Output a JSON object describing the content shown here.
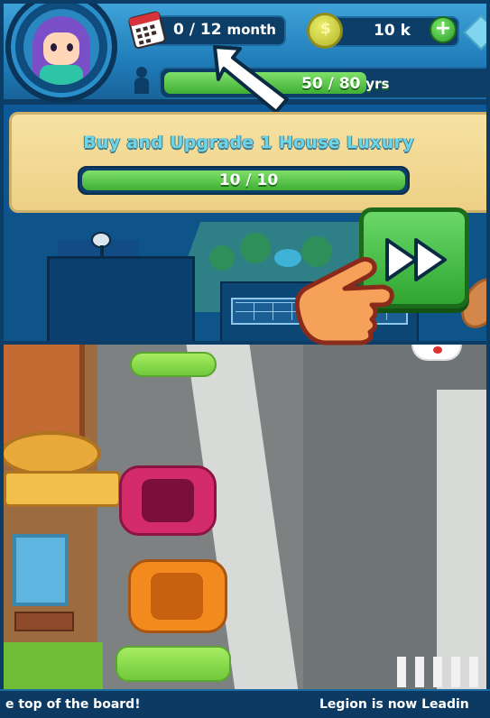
{
  "hud": {
    "month_current": "0 / ",
    "month_total": "12",
    "month_unit": "month",
    "coins": "10 k",
    "add_label": "+",
    "age_current": "50 / ",
    "age_total": "80",
    "age_unit": "yrs",
    "age_progress": 0.625
  },
  "quest": {
    "title": "Buy and Upgrade 1 House Luxury",
    "progress_text": "10 / 10",
    "progress": 1.0
  },
  "ticker": {
    "left_text": "e top of the board!",
    "right_text": "Legion is now Leadin"
  },
  "colors": {
    "hud_blue": "#1f7bb8",
    "progress_green": "#3fae34",
    "quest_panel": "#edd084",
    "quest_title": "#6cd5e8",
    "ff_button": "#2fa62f"
  },
  "icons": {
    "avatar": "avatar-icon",
    "calendar": "calendar-icon",
    "coin": "coin-icon",
    "gem": "gem-icon",
    "person": "person-icon",
    "arrow": "tutorial-arrow-icon",
    "fast_forward": "fast-forward-icon",
    "hand": "pointing-hand-icon"
  }
}
